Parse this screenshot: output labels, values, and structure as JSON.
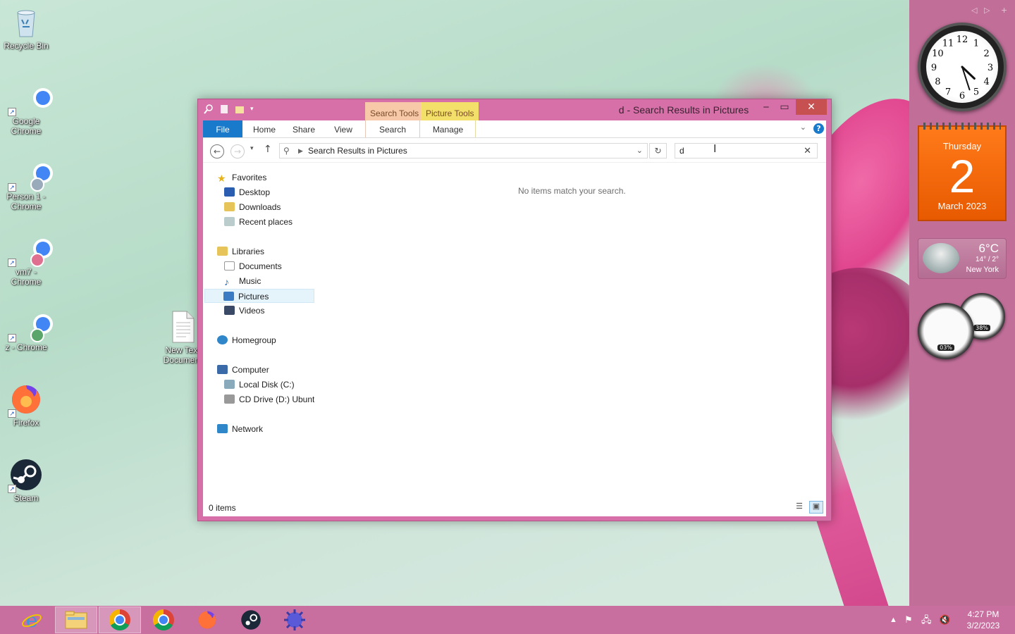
{
  "desktop": {
    "icons": [
      {
        "label": "Recycle Bin",
        "icon": "recycle-bin-icon"
      },
      {
        "label": "Google Chrome",
        "icon": "chrome-icon"
      },
      {
        "label": "Person 1 - Chrome",
        "icon": "chrome-profile-icon"
      },
      {
        "label": "vm7 - Chrome",
        "icon": "chrome-profile-icon"
      },
      {
        "label": "z - Chrome",
        "icon": "chrome-profile-icon"
      },
      {
        "label": "Firefox",
        "icon": "firefox-icon"
      },
      {
        "label": "Steam",
        "icon": "steam-icon"
      },
      {
        "label": "New Text Document",
        "icon": "text-document-icon"
      }
    ]
  },
  "window": {
    "title": "d - Search Results in Pictures",
    "context_tabs": [
      {
        "label": "Search Tools",
        "color": "#f7c9a8"
      },
      {
        "label": "Picture Tools",
        "color": "#f2e06a"
      }
    ],
    "ribbon_tabs": [
      "File",
      "Home",
      "Share",
      "View",
      "Search",
      "Manage"
    ],
    "address": {
      "path": "Search Results in Pictures"
    },
    "search": {
      "value": "d"
    },
    "navigation": {
      "favorites": {
        "label": "Favorites",
        "items": [
          "Desktop",
          "Downloads",
          "Recent places"
        ]
      },
      "libraries": {
        "label": "Libraries",
        "items": [
          "Documents",
          "Music",
          "Pictures",
          "Videos"
        ],
        "selected": "Pictures"
      },
      "homegroup": {
        "label": "Homegroup"
      },
      "computer": {
        "label": "Computer",
        "items": [
          "Local Disk (C:)",
          "CD Drive (D:) Ubuntu"
        ]
      },
      "network": {
        "label": "Network"
      }
    },
    "empty_message": "No items match your search.",
    "status": {
      "item_count": "0 items"
    }
  },
  "gadgets": {
    "clock": {
      "numbers": [
        "12",
        "1",
        "2",
        "3",
        "4",
        "5",
        "6",
        "7",
        "8",
        "9",
        "10",
        "11"
      ],
      "time": "4:27"
    },
    "calendar": {
      "weekday": "Thursday",
      "day": "2",
      "month_year": "March 2023"
    },
    "weather": {
      "temp": "6°C",
      "range": "14° / 2°",
      "city": "New York"
    },
    "meters": {
      "cpu": "03%",
      "memory": "38%"
    }
  },
  "taskbar": {
    "apps": [
      {
        "name": "Internet Explorer",
        "icon": "ie-icon"
      },
      {
        "name": "File Explorer",
        "icon": "folder-icon",
        "active": true
      },
      {
        "name": "Chrome Person 1",
        "icon": "chrome-profile-icon"
      },
      {
        "name": "Chrome vm7",
        "icon": "chrome-profile-icon"
      },
      {
        "name": "Firefox",
        "icon": "firefox-icon"
      },
      {
        "name": "Steam",
        "icon": "steam-icon"
      },
      {
        "name": "Ubuntu installer",
        "icon": "ubuntu-app-icon"
      }
    ],
    "clock": {
      "time": "4:27 PM",
      "date": "3/2/2023"
    }
  },
  "colors": {
    "accent": "#1979ca",
    "window_frame": "#d770a8",
    "taskbar": "#c86fa0",
    "close": "#c75050"
  }
}
